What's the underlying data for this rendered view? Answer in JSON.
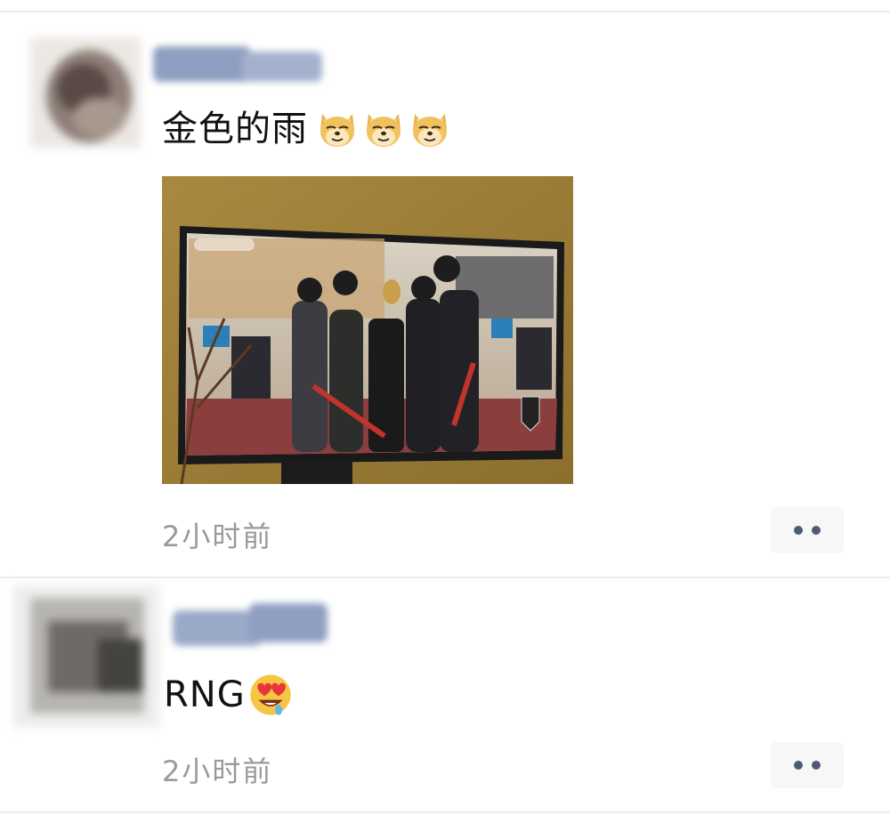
{
  "posts": [
    {
      "text": "金色的雨",
      "emojis": [
        "doge-icon",
        "doge-icon",
        "doge-icon"
      ],
      "time": "2小时前"
    },
    {
      "text": "RNG",
      "emojis": [
        "heart-eyes-drool-icon"
      ],
      "time": "2小时前"
    }
  ],
  "colors": {
    "time_text": "#9a9a9a",
    "more_dots": "#4e5a78",
    "more_bg": "#f7f7f7",
    "divider": "#ececec"
  }
}
